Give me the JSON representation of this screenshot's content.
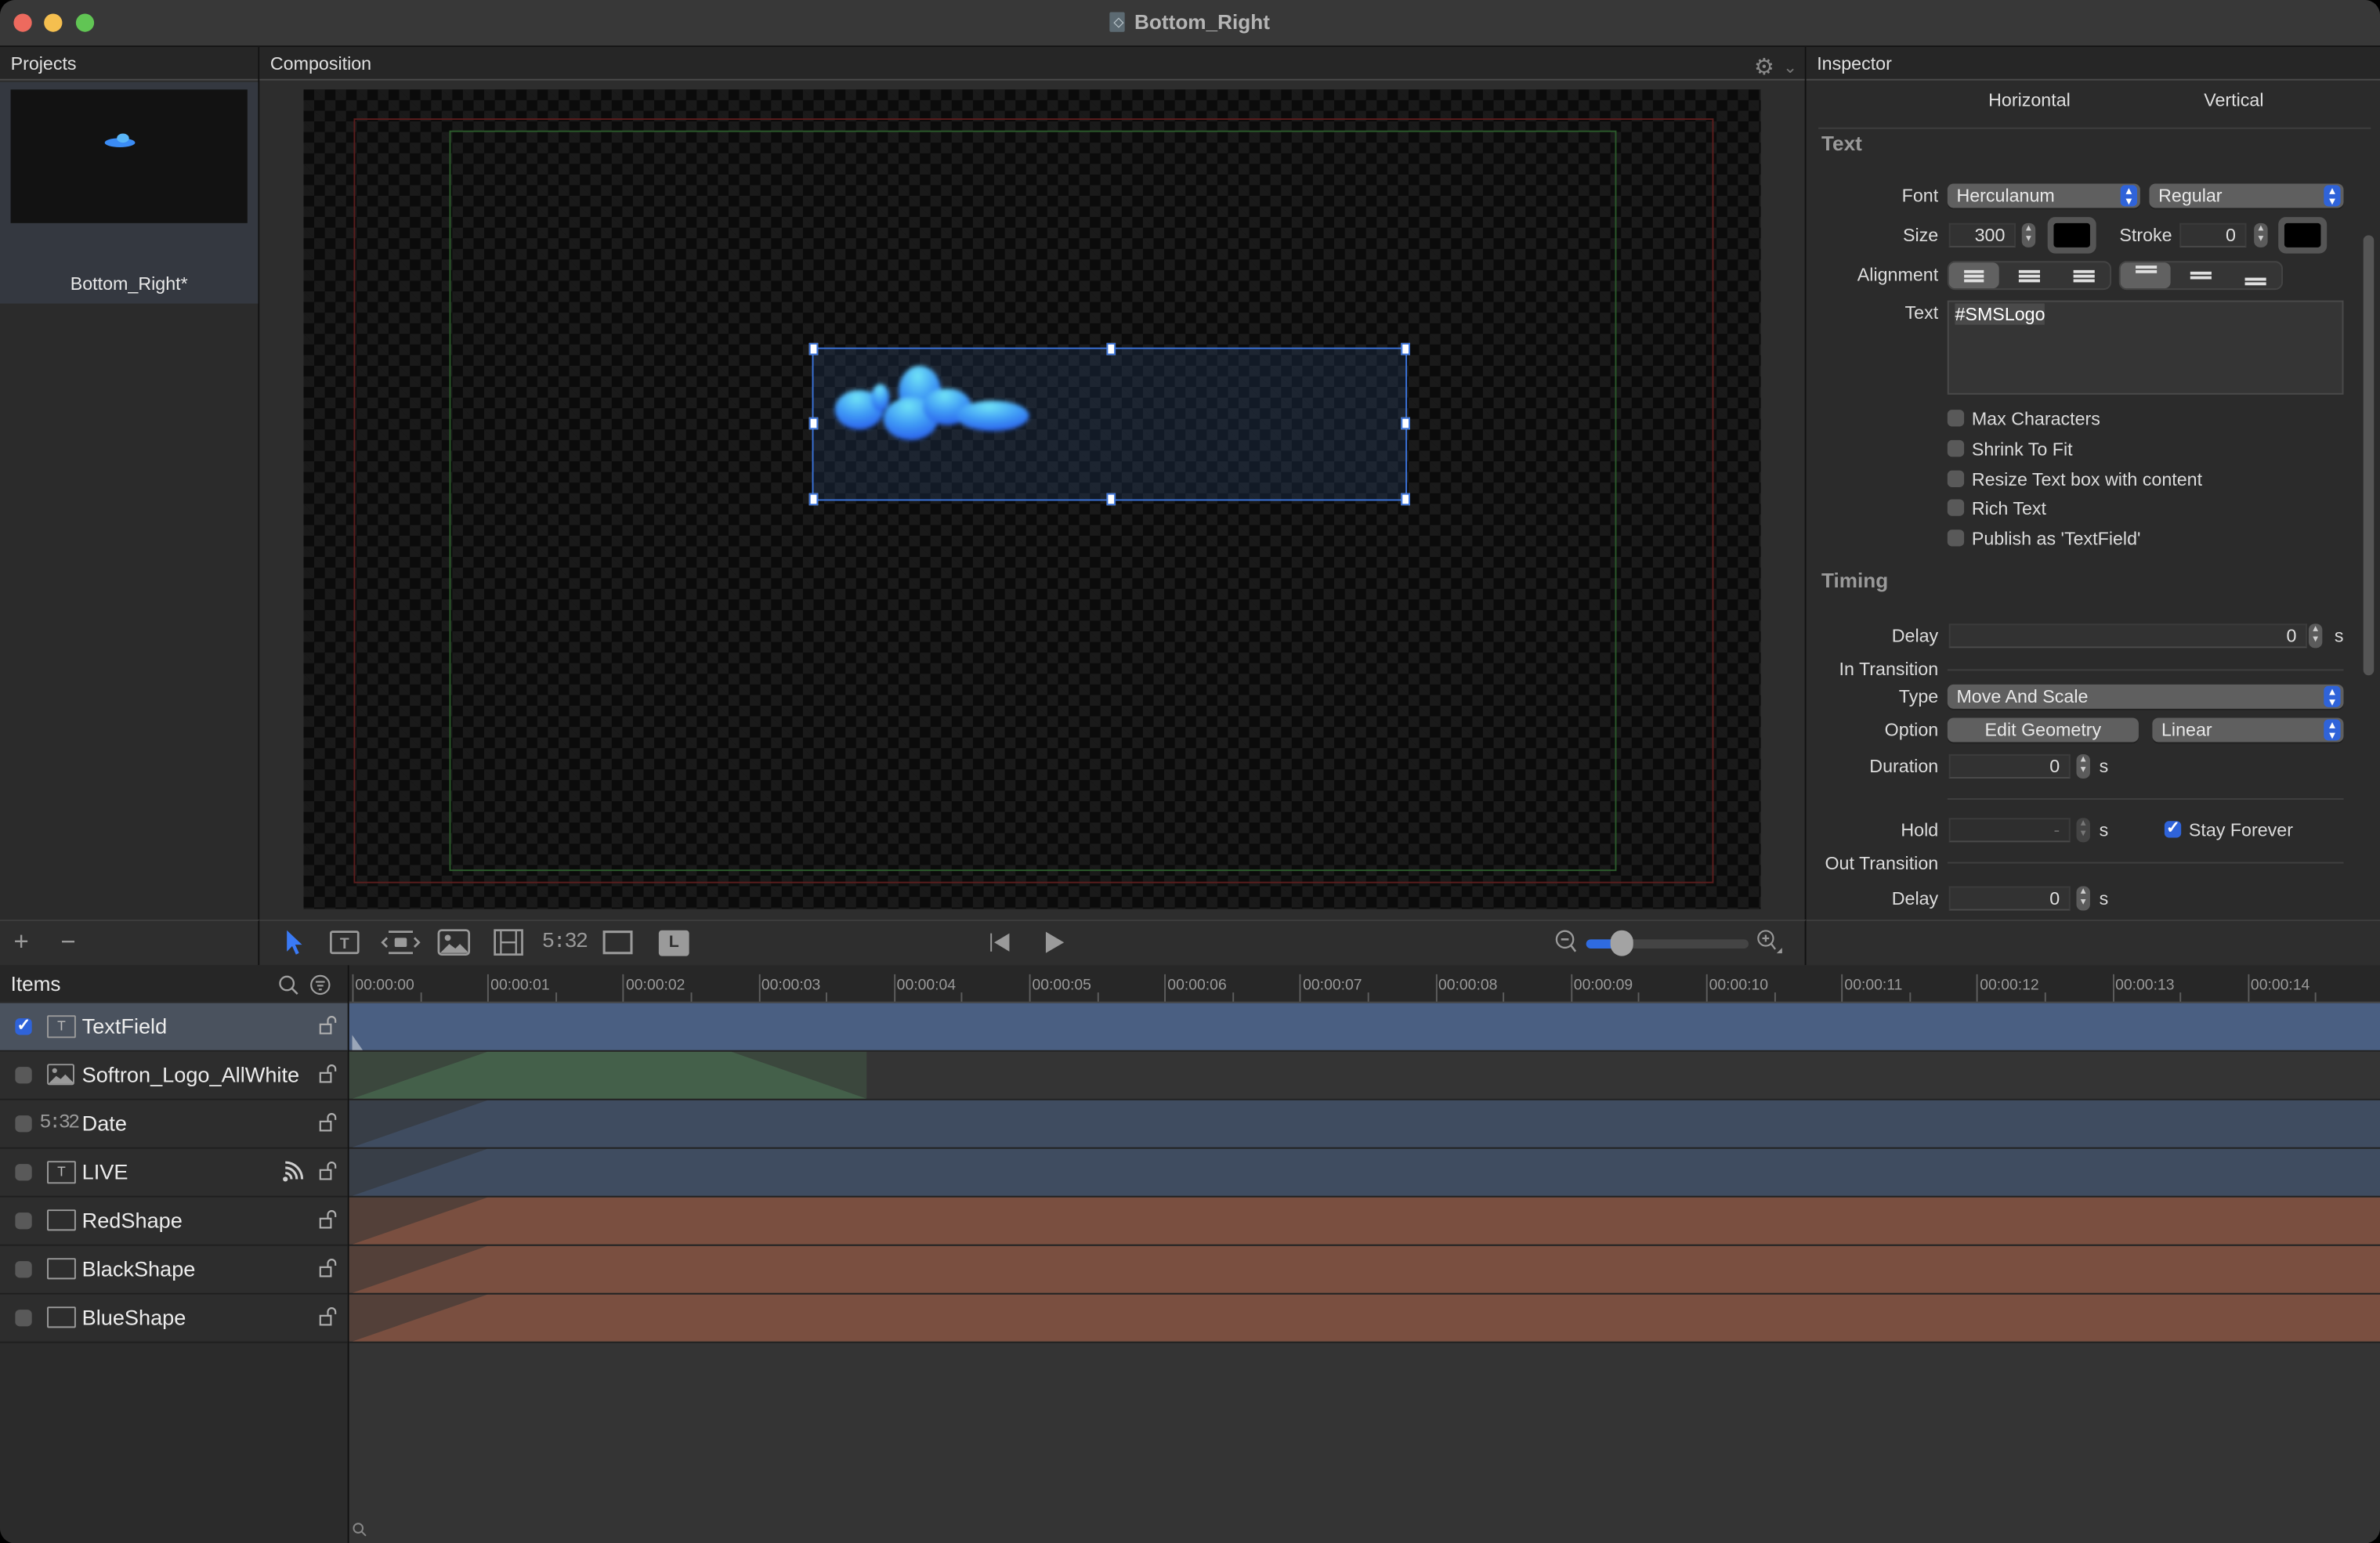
{
  "window": {
    "title": "Bottom_Right",
    "traffic_lights": {
      "close": "#ed6a5e",
      "minimize": "#f5bf4f",
      "zoom": "#61c554"
    }
  },
  "projects": {
    "header": "Projects",
    "items": [
      {
        "name": "Bottom_Right*"
      }
    ],
    "add_label": "+",
    "remove_label": "−"
  },
  "composition": {
    "header": "Composition",
    "settings_icon": "gear-icon",
    "menu_icon": "chevron-down-icon",
    "selected_item": "TextField"
  },
  "toolbar": {
    "tools": [
      {
        "name": "select-tool",
        "icon": "arrow-pointer-icon",
        "active": true
      },
      {
        "name": "text-tool",
        "icon": "text-box-icon"
      },
      {
        "name": "placeholder-tool",
        "icon": "folder-brackets-icon"
      },
      {
        "name": "image-tool",
        "icon": "image-icon"
      },
      {
        "name": "video-tool",
        "icon": "film-icon"
      },
      {
        "name": "clock-tool",
        "icon": "clock-digits-icon",
        "label": "5:32"
      },
      {
        "name": "shape-tool",
        "icon": "rectangle-icon"
      },
      {
        "name": "lower-third-tool",
        "icon": "L-badge-icon",
        "label": "L"
      }
    ],
    "playback": {
      "rewind_icon": "skip-to-start-icon",
      "play_icon": "play-icon"
    },
    "zoom_slider": {
      "value": 0.15,
      "min_icon": "zoom-out-icon",
      "max_icon": "zoom-in-icon"
    }
  },
  "inspector": {
    "header": "Inspector",
    "tabs": [
      "Horizontal",
      "Vertical"
    ],
    "text_section": {
      "title": "Text",
      "font_label": "Font",
      "font_family": "Herculanum",
      "font_style": "Regular",
      "size_label": "Size",
      "size_value": "300",
      "text_color": "#000000",
      "stroke_label": "Stroke",
      "stroke_value": "0",
      "stroke_color": "#000000",
      "alignment_label": "Alignment",
      "h_alignment": [
        "left",
        "center",
        "right"
      ],
      "h_alignment_selected": "left",
      "v_alignment": [
        "top",
        "middle",
        "bottom"
      ],
      "v_alignment_selected": "top",
      "text_label": "Text",
      "text_value": "#SMSLogo",
      "options": [
        {
          "label": "Max Characters",
          "checked": false
        },
        {
          "label": "Shrink To Fit",
          "checked": false
        },
        {
          "label": "Resize Text box with content",
          "checked": false
        },
        {
          "label": "Rich Text",
          "checked": false
        },
        {
          "label": "Publish as 'TextField'",
          "checked": false
        }
      ]
    },
    "timing_section": {
      "title": "Timing",
      "delay_label": "Delay",
      "delay_value": "0",
      "unit": "s",
      "in_transition_label": "In Transition",
      "type_label": "Type",
      "type_value": "Move And Scale",
      "option_label": "Option",
      "edit_geometry_label": "Edit Geometry",
      "easing_value": "Linear",
      "duration_label": "Duration",
      "duration_value": "0",
      "hold_label": "Hold",
      "hold_value": "-",
      "stay_forever_label": "Stay Forever",
      "stay_forever_checked": true,
      "out_transition_label": "Out Transition",
      "out_delay_label": "Delay",
      "out_delay_value": "0"
    }
  },
  "timeline": {
    "items_header": "Items",
    "search_icon": "search-icon",
    "filter_icon": "filter-icon",
    "ruler": [
      "00:00:00",
      "00:00:01",
      "00:00:02",
      "00:00:03",
      "00:00:04",
      "00:00:05",
      "00:00:06",
      "00:00:07",
      "00:00:08",
      "00:00:09",
      "00:00:10",
      "00:00:11",
      "00:00:12",
      "00:00:13",
      "00:00:14"
    ],
    "items": [
      {
        "name": "TextField",
        "type": "text",
        "checked": true,
        "selected": true,
        "live": false,
        "color": "#4a5f82",
        "start": 0,
        "in": 0,
        "end": null
      },
      {
        "name": "Softron_Logo_AllWhite",
        "type": "image",
        "checked": false,
        "selected": false,
        "live": false,
        "color": "#44604a",
        "start": 0,
        "in": 1.0,
        "out_start": 2.8,
        "end": 3.8
      },
      {
        "name": "Date",
        "type": "clock",
        "icon_label": "5:32",
        "checked": false,
        "selected": false,
        "live": false,
        "color": "#3f4c60",
        "start": 0,
        "in": 1.0,
        "end": null
      },
      {
        "name": "LIVE",
        "type": "text",
        "checked": false,
        "selected": false,
        "live": true,
        "color": "#3f4c60",
        "start": 0,
        "in": 1.0,
        "end": null
      },
      {
        "name": "RedShape",
        "type": "shape",
        "checked": false,
        "selected": false,
        "live": false,
        "color": "#7a4f40",
        "start": 0,
        "in": 1.0,
        "end": null
      },
      {
        "name": "BlackShape",
        "type": "shape",
        "checked": false,
        "selected": false,
        "live": false,
        "color": "#7a4f40",
        "start": 0,
        "in": 1.0,
        "end": null
      },
      {
        "name": "BlueShape",
        "type": "shape",
        "checked": false,
        "selected": false,
        "live": false,
        "color": "#7a4f40",
        "start": 0,
        "in": 1.0,
        "end": null
      }
    ]
  }
}
